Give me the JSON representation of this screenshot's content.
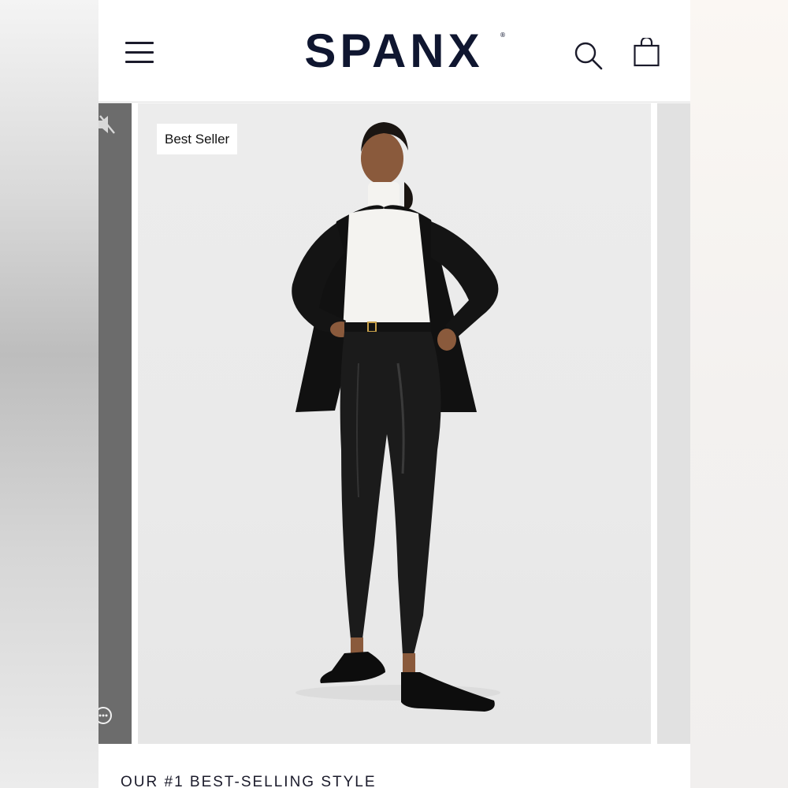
{
  "header": {
    "logo": "SPANX",
    "logo_mark": "®",
    "menu_icon": "hamburger-menu-icon",
    "search_icon": "search-icon",
    "bag_icon": "shopping-bag-icon"
  },
  "carousel": {
    "badge": "Best Seller",
    "prev_slide_icons": [
      "mute-icon",
      "more-icon"
    ],
    "image_alt": "Model wearing black faux leather leggings, white turtleneck and black blazer"
  },
  "section": {
    "heading": "OUR #1 BEST-SELLING STYLE"
  },
  "colors": {
    "brand_navy": "#0f1630",
    "image_background": "#ebebeb"
  }
}
